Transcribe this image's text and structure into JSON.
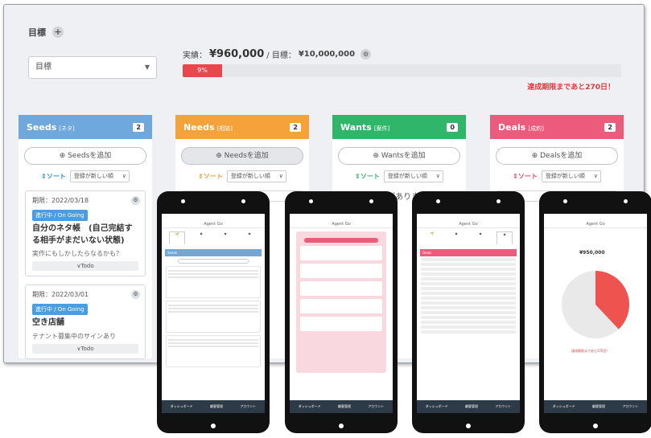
{
  "goal": {
    "heading": "目標",
    "add_icon": "plus-icon",
    "select_value": "目標",
    "actual_label": "実績：",
    "actual_value": "¥960,000",
    "target_label": "/ 目標：",
    "target_value": "¥10,000,000",
    "progress_text": "9%",
    "progress_fraction": 0.09,
    "deadline": "達成期限まであと270日！"
  },
  "columns": [
    {
      "title": "Seeds",
      "sub": "[ネタ]",
      "count": "2",
      "color": "#6fa8dc",
      "add_label": "Seedsを追加",
      "sort_label": "ソート",
      "sort_value": "登録が新しい順",
      "cards": [
        {
          "due": "期限：2022/03/18",
          "status": "進行中 / On Going",
          "title": "自分のネタ帳　(自己完結する相手がまだいない状態)",
          "note": "実作にもしかしたらなるかも？",
          "todo": "∨Todo"
        },
        {
          "due": "期限：2022/03/01",
          "status": "進行中 / On Going",
          "title": "空き店舗",
          "note": "テナント募集中のサインあり",
          "todo": "∨Todo"
        }
      ]
    },
    {
      "title": "Needs",
      "sub": "[相談]",
      "count": "2",
      "color": "#f5a23a",
      "add_label": "Needsを追加",
      "sort_label": "ソート",
      "sort_value": "登録が新しい順"
    },
    {
      "title": "Wants",
      "sub": "[案件]",
      "count": "0",
      "color": "#2fb66a",
      "add_label": "Wantsを追加",
      "sort_label": "ソート",
      "sort_value": "登録が新しい順",
      "empty_text": "データがありません"
    },
    {
      "title": "Deals",
      "sub": "[成約]",
      "count": "2",
      "color": "#ec5b7b",
      "add_label": "Dealsを追加",
      "sort_label": "ソート",
      "sort_value": "登録が新しい順"
    }
  ],
  "phones": {
    "app_title": "Agent Go",
    "tab_labels": [
      "ダッシュボード",
      "顧客管理",
      "アカウント"
    ],
    "pie_value": "¥950,000",
    "pie_fraction": 0.38
  }
}
